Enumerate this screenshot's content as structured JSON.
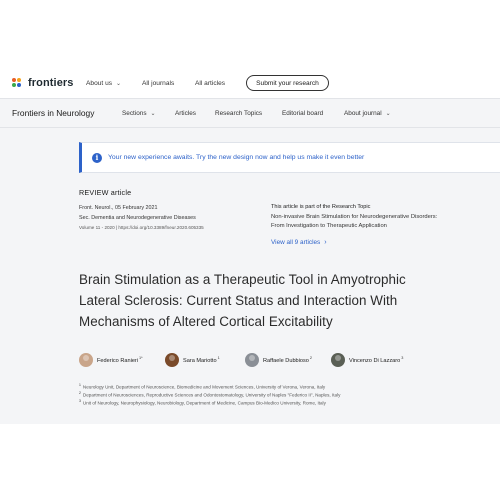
{
  "colors": {
    "accent": "#2d62c9",
    "page_bg": "#f4f5f7",
    "logo_dots": [
      "#e85d26",
      "#f5a31a",
      "#3aa84a",
      "#2d62c9"
    ]
  },
  "header": {
    "logo_text": "frontiers",
    "nav": [
      {
        "label": "About us",
        "has_chevron": true
      },
      {
        "label": "All journals",
        "has_chevron": false
      },
      {
        "label": "All articles",
        "has_chevron": false
      }
    ],
    "submit_label": "Submit your research"
  },
  "journal_bar": {
    "title": "Frontiers in Neurology",
    "nav": [
      {
        "label": "Sections",
        "has_chevron": true
      },
      {
        "label": "Articles",
        "has_chevron": false
      },
      {
        "label": "Research Topics",
        "has_chevron": false
      },
      {
        "label": "Editorial board",
        "has_chevron": false
      },
      {
        "label": "About journal",
        "has_chevron": true
      }
    ]
  },
  "banner": {
    "icon": "info-icon",
    "text": "Your new experience awaits. Try the new design now and help us make it even better"
  },
  "article": {
    "type": "REVIEW article",
    "citation": "Front. Neurol., 05 February 2021",
    "section": "Sec. Dementia and Neurodegenerative Diseases",
    "volume_doi": "Volume 11 - 2020 | https://doi.org/10.3389/fneur.2020.605335",
    "title_lines": [
      "Brain Stimulation as a Therapeutic Tool in Amyotrophic",
      "Lateral Sclerosis: Current Status and Interaction With",
      "Mechanisms of Altered Cortical Excitability"
    ],
    "authors": [
      {
        "name": "Federico Ranieri",
        "sup": "1*",
        "avatar_color": "#c9a58a"
      },
      {
        "name": "Sara Mariotto",
        "sup": "1",
        "avatar_color": "#7a4a2a"
      },
      {
        "name": "Raffaele Dubbioso",
        "sup": "2",
        "avatar_color": "#8a8f96"
      },
      {
        "name": "Vincenzo Di Lazzaro",
        "sup": "3",
        "avatar_color": "#5a5f55"
      }
    ],
    "affiliations": [
      {
        "num": "1",
        "text": "Neurology Unit, Department of Neuroscience, Biomedicine and Movement Sciences, University of Verona, Verona, Italy"
      },
      {
        "num": "2",
        "text": "Department of Neurosciences, Reproductive Sciences and Odontostomatology, University of Naples \"Federico II\", Naples, Italy"
      },
      {
        "num": "3",
        "text": "Unit of Neurology, Neurophysiology, Neurobiology, Department of Medicine, Campus Bio-Medico University, Rome, Italy"
      }
    ]
  },
  "research_topic": {
    "label": "This article is part of the Research Topic",
    "title_lines": [
      "Non-invasive Brain Stimulation for Neurodegenerative Disorders:",
      "From Investigation to Therapeutic Application"
    ],
    "link_label": "View all 9 articles"
  }
}
